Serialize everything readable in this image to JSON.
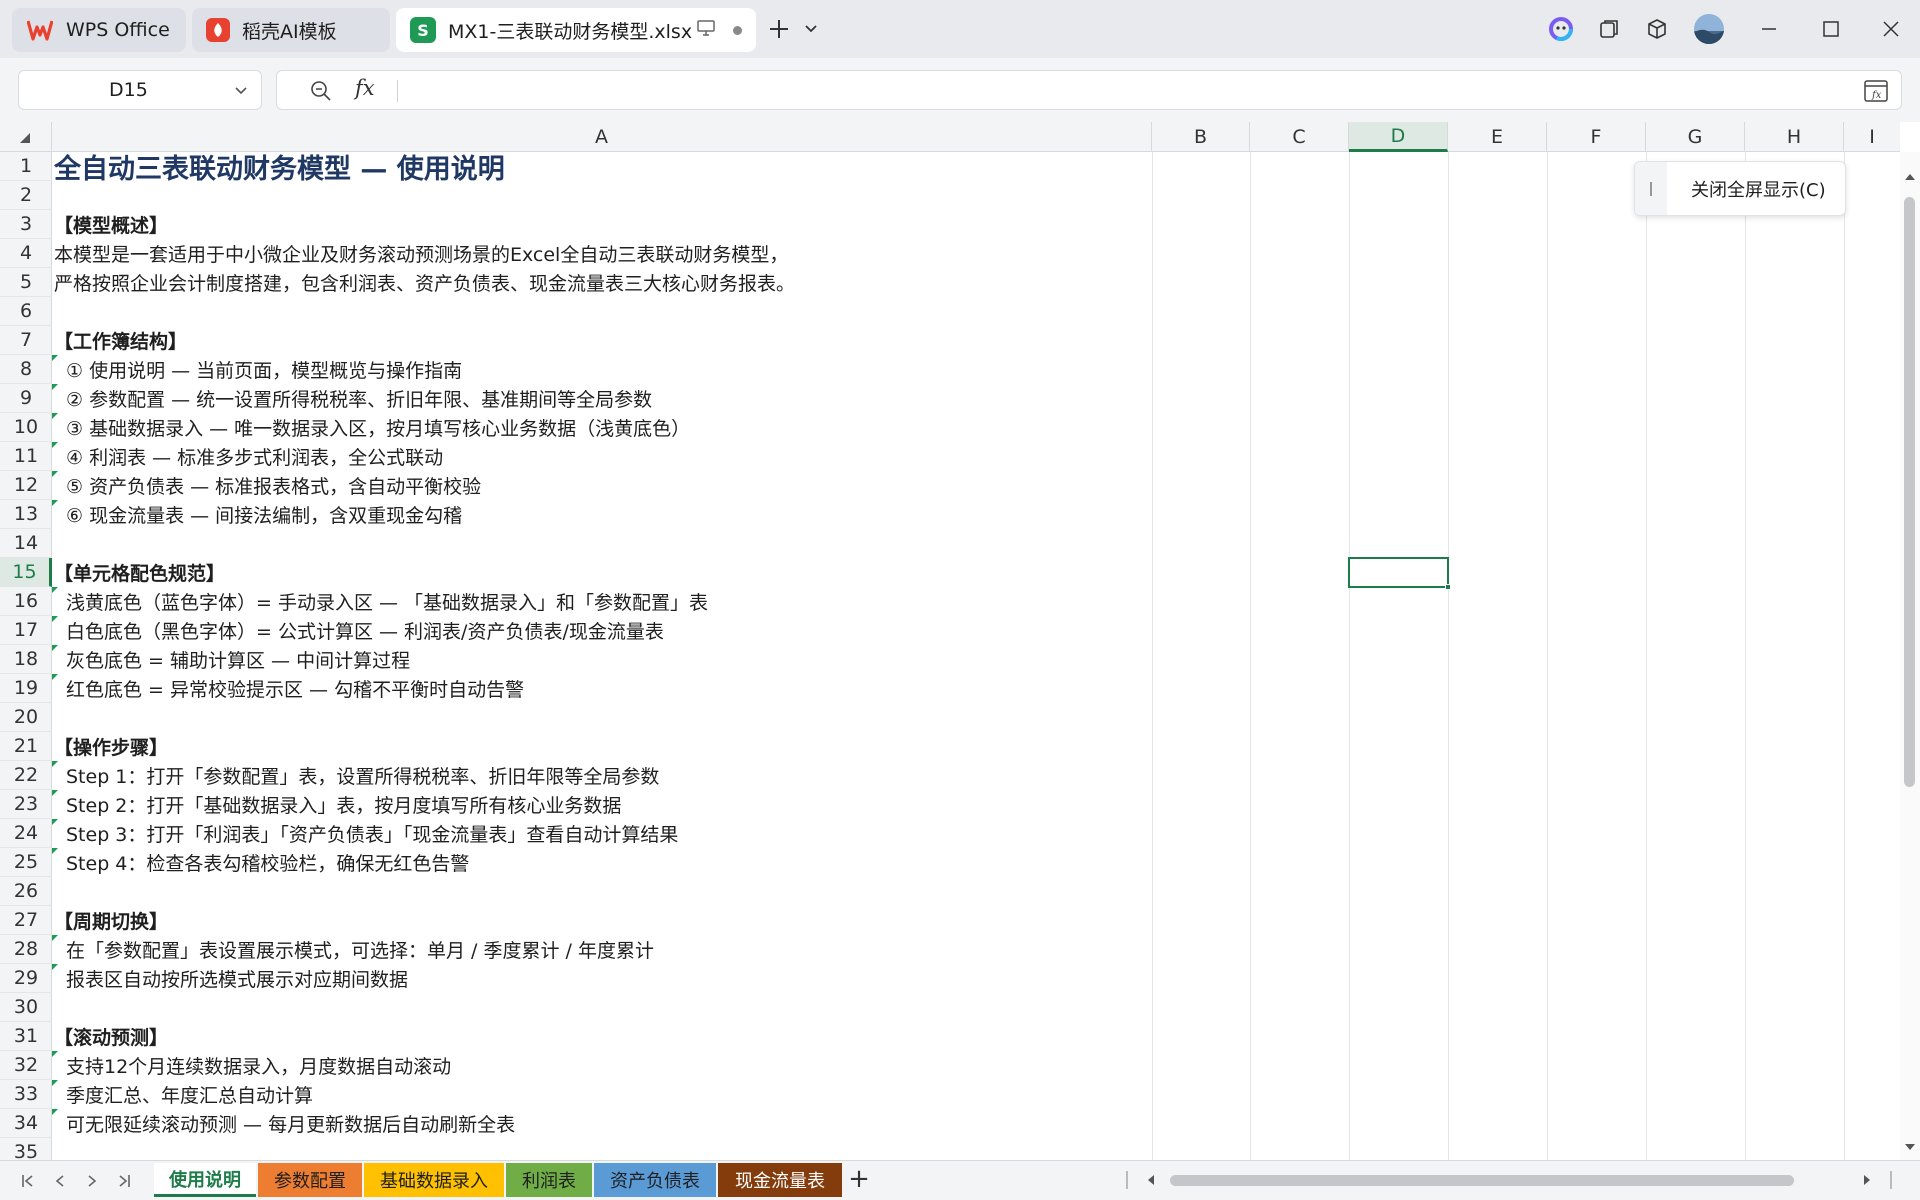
{
  "app": {
    "tabs": [
      {
        "label": "WPS Office",
        "logo": "W",
        "color": "#e8412f"
      },
      {
        "label": "稻壳AI模板",
        "logo": "稻",
        "color": "#e8412f"
      },
      {
        "label": "MX1-三表联动财务模型.xlsx",
        "logo": "S",
        "color": "#1e9a55"
      }
    ],
    "accent": "#1e7c4a"
  },
  "formula_bar": {
    "name_box": "D15",
    "fx_label": "fx",
    "formula_value": ""
  },
  "columns": [
    "A",
    "B",
    "C",
    "D",
    "E",
    "F",
    "G",
    "H",
    "I"
  ],
  "selected_column": "D",
  "selected_row": "15",
  "rows": [
    {
      "n": "1",
      "text": "全自动三表联动财务模型 — 使用说明",
      "style": "title"
    },
    {
      "n": "2",
      "text": "",
      "style": "plain"
    },
    {
      "n": "3",
      "text": "【模型概述】",
      "style": "section"
    },
    {
      "n": "4",
      "text": "本模型是一套适用于中小微企业及财务滚动预测场景的Excel全自动三表联动财务模型，",
      "style": "plain"
    },
    {
      "n": "5",
      "text": "严格按照企业会计制度搭建，包含利润表、资产负债表、现金流量表三大核心财务报表。",
      "style": "plain"
    },
    {
      "n": "6",
      "text": "",
      "style": "plain"
    },
    {
      "n": "7",
      "text": "【工作簿结构】",
      "style": "section"
    },
    {
      "n": "8",
      "text": "① 使用说明 — 当前页面，模型概览与操作指南",
      "style": "item"
    },
    {
      "n": "9",
      "text": "② 参数配置 — 统一设置所得税税率、折旧年限、基准期间等全局参数",
      "style": "item"
    },
    {
      "n": "10",
      "text": "③ 基础数据录入 — 唯一数据录入区，按月填写核心业务数据（浅黄底色）",
      "style": "item"
    },
    {
      "n": "11",
      "text": "④ 利润表 — 标准多步式利润表，全公式联动",
      "style": "item"
    },
    {
      "n": "12",
      "text": "⑤ 资产负债表 — 标准报表格式，含自动平衡校验",
      "style": "item"
    },
    {
      "n": "13",
      "text": "⑥ 现金流量表 — 间接法编制，含双重现金勾稽",
      "style": "item"
    },
    {
      "n": "14",
      "text": "",
      "style": "plain"
    },
    {
      "n": "15",
      "text": "【单元格配色规范】",
      "style": "section"
    },
    {
      "n": "16",
      "text": "浅黄底色（蓝色字体）= 手动录入区 — 「基础数据录入」和「参数配置」表",
      "style": "item"
    },
    {
      "n": "17",
      "text": "白色底色（黑色字体）= 公式计算区 — 利润表/资产负债表/现金流量表",
      "style": "item"
    },
    {
      "n": "18",
      "text": "灰色底色 = 辅助计算区 — 中间计算过程",
      "style": "item"
    },
    {
      "n": "19",
      "text": "红色底色 = 异常校验提示区 — 勾稽不平衡时自动告警",
      "style": "item"
    },
    {
      "n": "20",
      "text": "",
      "style": "plain"
    },
    {
      "n": "21",
      "text": "【操作步骤】",
      "style": "section"
    },
    {
      "n": "22",
      "text": "Step 1：打开「参数配置」表，设置所得税税率、折旧年限等全局参数",
      "style": "item"
    },
    {
      "n": "23",
      "text": "Step 2：打开「基础数据录入」表，按月度填写所有核心业务数据",
      "style": "item"
    },
    {
      "n": "24",
      "text": "Step 3：打开「利润表」「资产负债表」「现金流量表」查看自动计算结果",
      "style": "item"
    },
    {
      "n": "25",
      "text": "Step 4：检查各表勾稽校验栏，确保无红色告警",
      "style": "item"
    },
    {
      "n": "26",
      "text": "",
      "style": "plain"
    },
    {
      "n": "27",
      "text": "【周期切换】",
      "style": "section"
    },
    {
      "n": "28",
      "text": "在「参数配置」表设置展示模式，可选择：单月 / 季度累计 / 年度累计",
      "style": "item"
    },
    {
      "n": "29",
      "text": "报表区自动按所选模式展示对应期间数据",
      "style": "item"
    },
    {
      "n": "30",
      "text": "",
      "style": "plain"
    },
    {
      "n": "31",
      "text": "【滚动预测】",
      "style": "section"
    },
    {
      "n": "32",
      "text": "支持12个月连续数据录入，月度数据自动滚动",
      "style": "item"
    },
    {
      "n": "33",
      "text": "季度汇总、年度汇总自动计算",
      "style": "item"
    },
    {
      "n": "34",
      "text": "可无限延续滚动预测 — 每月更新数据后自动刷新全表",
      "style": "item"
    },
    {
      "n": "35",
      "text": "",
      "style": "plain"
    }
  ],
  "fullscreen_popup": {
    "label": "关闭全屏显示(C)"
  },
  "sheets": [
    {
      "label": "使用说明",
      "color": "#ffffff",
      "active": true
    },
    {
      "label": "参数配置",
      "color": "#ed7d31",
      "active": false
    },
    {
      "label": "基础数据录入",
      "color": "#ffc000",
      "active": false
    },
    {
      "label": "利润表",
      "color": "#70ad47",
      "active": false
    },
    {
      "label": "资产负债表",
      "color": "#5b9bd5",
      "active": false
    },
    {
      "label": "现金流量表",
      "color": "#843c0c",
      "active": false
    }
  ],
  "sheet_add_label": "+"
}
